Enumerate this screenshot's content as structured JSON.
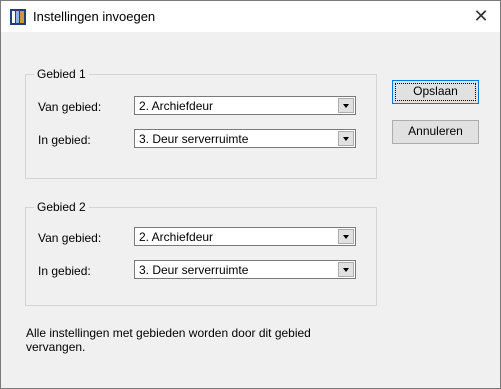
{
  "window": {
    "title": "Instellingen invoegen",
    "close_symbol": "✕",
    "icon": "app-icon"
  },
  "groups": [
    {
      "legend": "Gebied 1",
      "from_label": "Van gebied:",
      "from_value": "2. Archiefdeur",
      "to_label": "In gebied:",
      "to_value": "3. Deur serverruimte"
    },
    {
      "legend": "Gebied 2",
      "from_label": "Van gebied:",
      "from_value": "2. Archiefdeur",
      "to_label": "In gebied:",
      "to_value": "3. Deur serverruimte"
    }
  ],
  "buttons": {
    "save": "Opslaan",
    "cancel": "Annuleren"
  },
  "note": "Alle instellingen met gebieden worden door dit gebied vervangen.",
  "colors": {
    "dialog_bg": "#f0f0f0",
    "titlebar_bg": "#ffffff",
    "default_button_border": "#0078d7"
  }
}
